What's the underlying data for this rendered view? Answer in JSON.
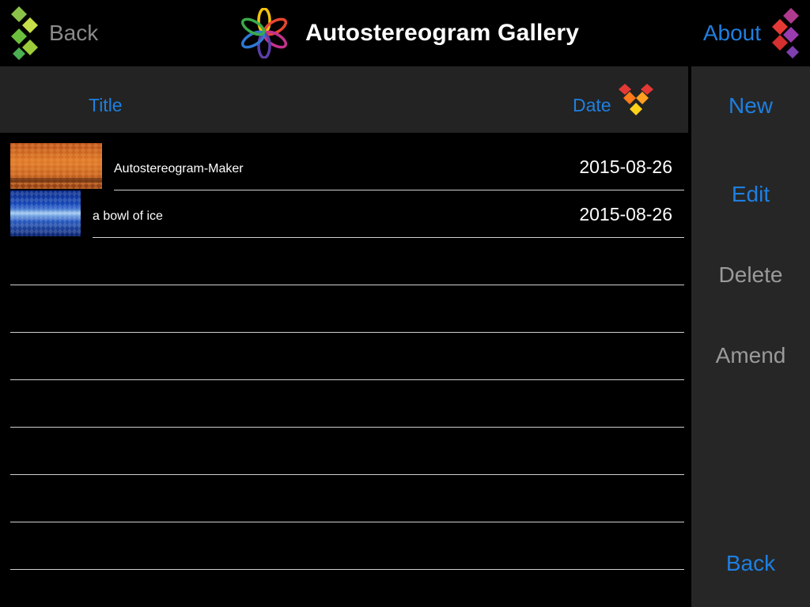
{
  "header": {
    "back_label": "Back",
    "title": "Autostereogram Gallery",
    "about_label": "About"
  },
  "columns": {
    "title_label": "Title",
    "date_label": "Date"
  },
  "rows": [
    {
      "name": "Autostereogram-Maker",
      "date": "2015-08-26"
    },
    {
      "name": "a bowl of ice",
      "date": "2015-08-26"
    }
  ],
  "sidebar": {
    "new_label": "New",
    "edit_label": "Edit",
    "delete_label": "Delete",
    "amend_label": "Amend",
    "back_label": "Back"
  },
  "colors": {
    "accent_blue": "#1e7fe0",
    "disabled_gray": "#9a9a9a",
    "panel_bg": "#262626",
    "header_bg": "#232323"
  },
  "icons": {
    "back": "green-diamonds-icon",
    "logo": "flower-logo-icon",
    "about": "red-purple-diamonds-icon",
    "sort": "orange-diamonds-sort-icon"
  }
}
